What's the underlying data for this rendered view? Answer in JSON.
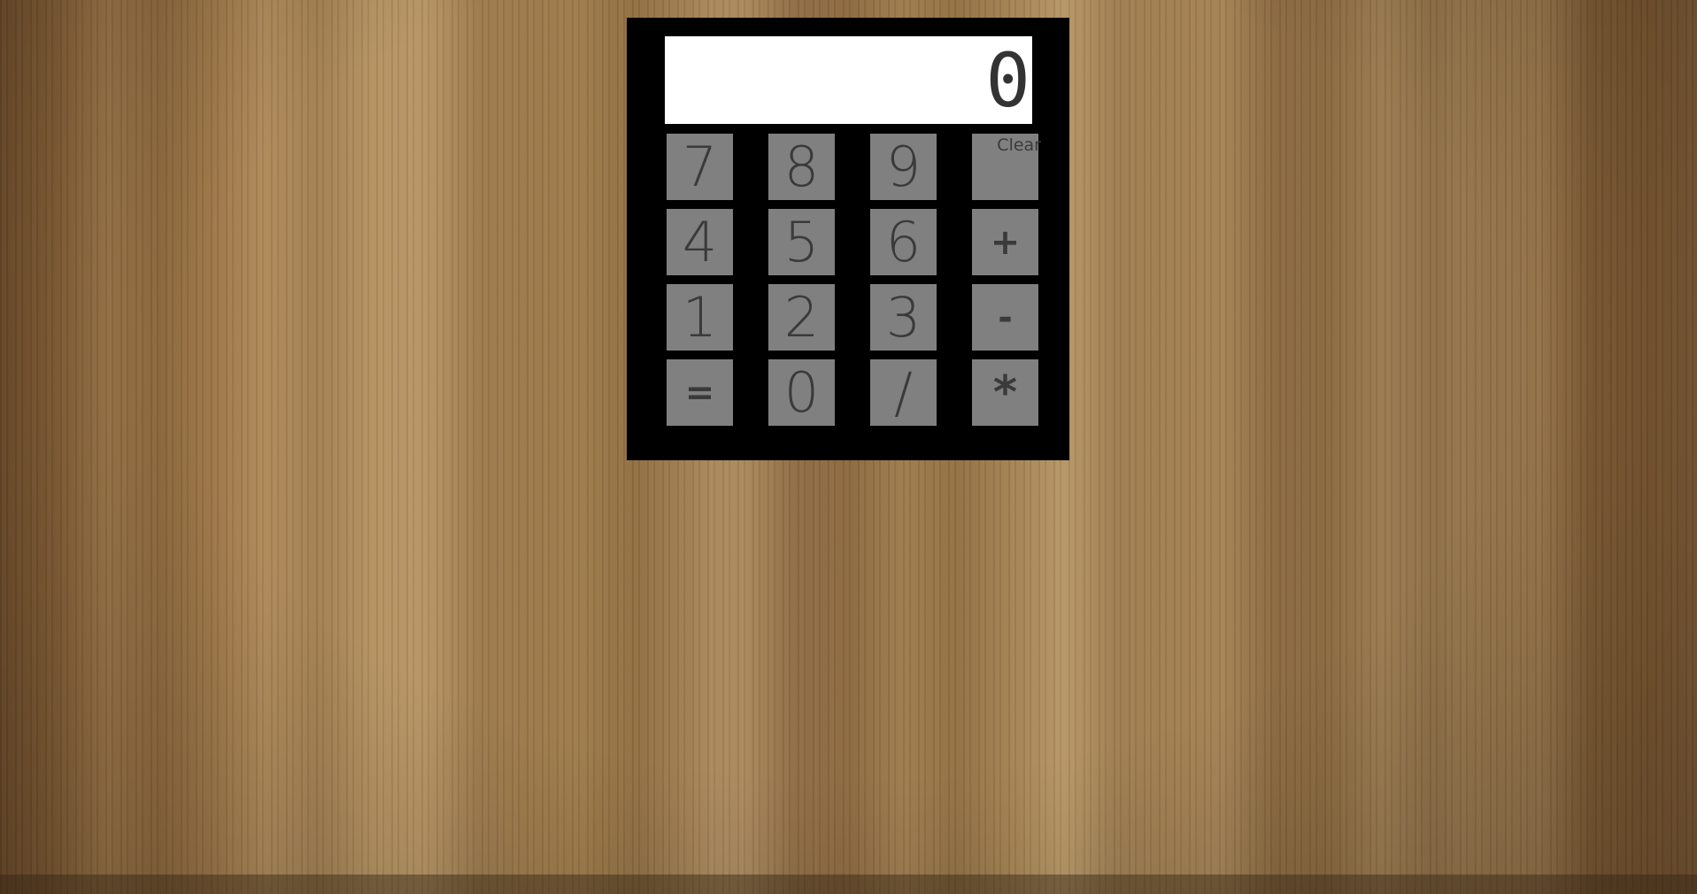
{
  "display": {
    "value": "0"
  },
  "keypad": {
    "rows": [
      [
        {
          "label": "7",
          "name": "key-7"
        },
        {
          "label": "8",
          "name": "key-8"
        },
        {
          "label": "9",
          "name": "key-9"
        },
        {
          "label": "Clear",
          "name": "clear-button"
        }
      ],
      [
        {
          "label": "4",
          "name": "key-4"
        },
        {
          "label": "5",
          "name": "key-5"
        },
        {
          "label": "6",
          "name": "key-6"
        },
        {
          "label": "+",
          "name": "add-button"
        }
      ],
      [
        {
          "label": "1",
          "name": "key-1"
        },
        {
          "label": "2",
          "name": "key-2"
        },
        {
          "label": "3",
          "name": "key-3"
        },
        {
          "label": "-",
          "name": "subtract-button"
        }
      ],
      [
        {
          "label": "=",
          "name": "equals-button"
        },
        {
          "label": "0",
          "name": "key-0"
        },
        {
          "label": "/",
          "name": "divide-button"
        },
        {
          "label": "*",
          "name": "multiply-button"
        }
      ]
    ]
  },
  "colors": {
    "calculator_body": "#000000",
    "display_background": "#ffffff",
    "key_background": "#808080",
    "key_text": "#3a3a3a"
  }
}
